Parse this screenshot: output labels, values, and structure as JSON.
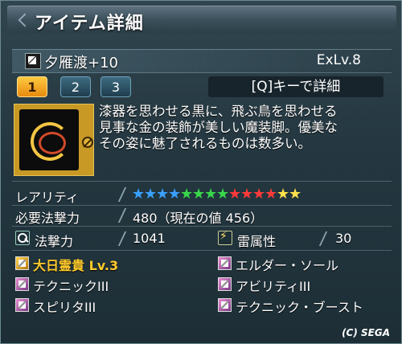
{
  "window": {
    "title": "アイテム詳細"
  },
  "item": {
    "name": "夕雁渡+10",
    "ex_level": "ExLv.8",
    "description_lines": [
      "漆器を思わせる黒に、飛ぶ鳥を思わせる",
      "見事な金の装飾が美しい魔装脚。優美な",
      "その姿に魅了されるものは数多い。"
    ]
  },
  "tabs": [
    {
      "label": "1",
      "active": true
    },
    {
      "label": "2",
      "active": false
    },
    {
      "label": "3",
      "active": false
    }
  ],
  "detail_button": {
    "label": "[Q]キーで詳細"
  },
  "stats": {
    "rarity_label": "レアリティ",
    "rarity_value": 14,
    "rarity_max": 14,
    "star_colors": [
      "#3aa0ff",
      "#3aa0ff",
      "#3aa0ff",
      "#3aa0ff",
      "#38d84a",
      "#38d84a",
      "#38d84a",
      "#38d84a",
      "#ff3a3a",
      "#ff3a3a",
      "#ff3a3a",
      "#ff3a3a",
      "#ffe24a",
      "#ffe24a"
    ],
    "required_label": "必要法撃力",
    "required_value": "480（現在の値 456）",
    "tech_label": "法撃力",
    "tech_value": "1041",
    "element_label": "雷属性",
    "element_value": "30"
  },
  "abilities": [
    {
      "label": "大日霊貴 Lv.3",
      "special": true
    },
    {
      "label": "エルダー・ソール",
      "special": false
    },
    {
      "label": "テクニックIII",
      "special": false
    },
    {
      "label": "アビリティIII",
      "special": false
    },
    {
      "label": "スピリタIII",
      "special": false
    },
    {
      "label": "テクニック・ブースト",
      "special": false
    }
  ],
  "copyright": "(C) SEGA"
}
